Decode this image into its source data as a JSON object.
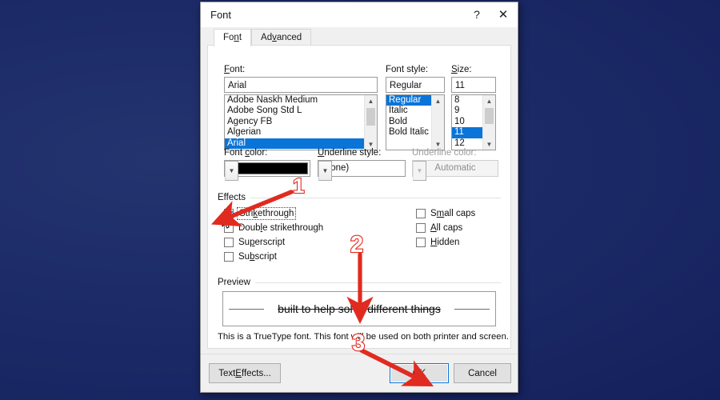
{
  "window": {
    "title": "Font",
    "help_label": "?",
    "close_label": "✕"
  },
  "tabs": [
    {
      "label": "Font",
      "accel": "n",
      "active": true
    },
    {
      "label": "Advanced",
      "accel": "v",
      "active": false
    }
  ],
  "font_section": {
    "font_label": "Font:",
    "font_label_accel": "F",
    "font_value": "Arial",
    "font_list": [
      "Adobe Naskh Medium",
      "Adobe Song Std L",
      "Agency FB",
      "Algerian",
      "Arial"
    ],
    "font_selected": "Arial",
    "style_label": "Font style:",
    "style_value": "Regular",
    "style_list": [
      "Regular",
      "Italic",
      "Bold",
      "Bold Italic"
    ],
    "style_selected": "Regular",
    "size_label": "Size:",
    "size_label_accel": "S",
    "size_value": "11",
    "size_list": [
      "8",
      "9",
      "10",
      "11",
      "12"
    ],
    "size_selected": "11"
  },
  "color_row": {
    "font_color_label": "Font color:",
    "font_color_accel": "c",
    "font_color_value": "#000000",
    "underline_style_label": "Underline style:",
    "underline_style_accel": "U",
    "underline_style_value": "(none)",
    "underline_color_label": "Underline color:",
    "underline_color_value": "Automatic",
    "underline_color_disabled": true
  },
  "effects": {
    "group_label": "Effects",
    "left_items": [
      {
        "label": "Strikethrough",
        "accel": "k",
        "checked": true,
        "focused": true
      },
      {
        "label": "Double strikethrough",
        "accel": "l",
        "checked": false,
        "focused": false
      },
      {
        "label": "Superscript",
        "accel": "p",
        "checked": false,
        "focused": false
      },
      {
        "label": "Subscript",
        "accel": "b",
        "checked": false,
        "focused": false
      }
    ],
    "right_items": [
      {
        "label": "Small caps",
        "accel": "m",
        "checked": false,
        "focused": false
      },
      {
        "label": "All caps",
        "accel": "A",
        "checked": false,
        "focused": false
      },
      {
        "label": "Hidden",
        "accel": "H",
        "checked": false,
        "focused": false
      }
    ]
  },
  "preview": {
    "group_label": "Preview",
    "sample_text": "built to help solve different things",
    "info_text": "This is a TrueType font. This font will be used on both printer and screen."
  },
  "footer": {
    "text_effects_label": "Text Effects...",
    "text_effects_accel": "E",
    "ok_label": "OK",
    "cancel_label": "Cancel"
  },
  "annotations": [
    {
      "number": "1",
      "target": "strikethrough-checkbox"
    },
    {
      "number": "2",
      "target": "preview-sample-text"
    },
    {
      "number": "3",
      "target": "ok-button"
    }
  ],
  "colors": {
    "desktop_background": "#1b2a68",
    "selection_blue": "#0a74d8",
    "annotation_red": "#e02b20",
    "dialog_background": "#f0f0f0"
  }
}
